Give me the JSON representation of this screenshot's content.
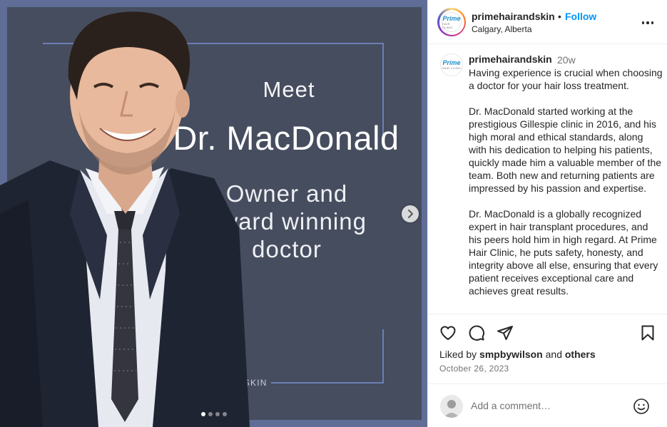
{
  "post": {
    "image": {
      "meet_text": "Meet",
      "doctor_name": "Dr. MacDonald",
      "tagline_lines": [
        "Owner and",
        "award winning",
        "doctor"
      ],
      "watermark_handle": "@PRIMEHAIRANDSKIN",
      "carousel": {
        "total_slides": 4,
        "active_index": 0
      },
      "next_icon": "chevron-right-icon"
    },
    "header": {
      "username": "primehairandskin",
      "separator": "•",
      "follow_label": "Follow",
      "location": "Calgary, Alberta",
      "logo_text": "Prime",
      "logo_subtext": "HAIR CLINIC",
      "more_icon": "more-horizontal-icon"
    },
    "caption": {
      "username": "primehairandskin",
      "time_ago": "20w",
      "paragraphs": [
        "Having experience is crucial when choosing a doctor for your hair loss treatment.",
        "Dr. MacDonald started working at the prestigious Gillespie clinic in 2016, and his high moral and ethical standards, along with his dedication to helping his patients, quickly made him a valuable member of the team. Both new and returning patients are impressed by his passion and expertise.",
        "Dr. MacDonald is a globally recognized expert in hair transplant procedures, and his peers hold him in high regard. At Prime Hair Clinic, he puts safety, honesty, and integrity above all else, ensuring that every patient receives exceptional care and achieves great results."
      ]
    },
    "actions": {
      "like_icon": "heart-icon",
      "comment_icon": "comment-icon",
      "share_icon": "share-icon",
      "save_icon": "bookmark-icon"
    },
    "likes": {
      "prefix": "Liked by",
      "user": "smpbywilson",
      "connector": "and",
      "others": "others"
    },
    "date": "October 26, 2023",
    "comment_box": {
      "placeholder": "Add a comment…",
      "emoji_icon": "emoji-smile-icon"
    }
  },
  "colors": {
    "follow_blue": "#0095f6",
    "card_background": "#464d5e",
    "frame_blue": "#5f6d97",
    "muted_text": "#737373"
  }
}
